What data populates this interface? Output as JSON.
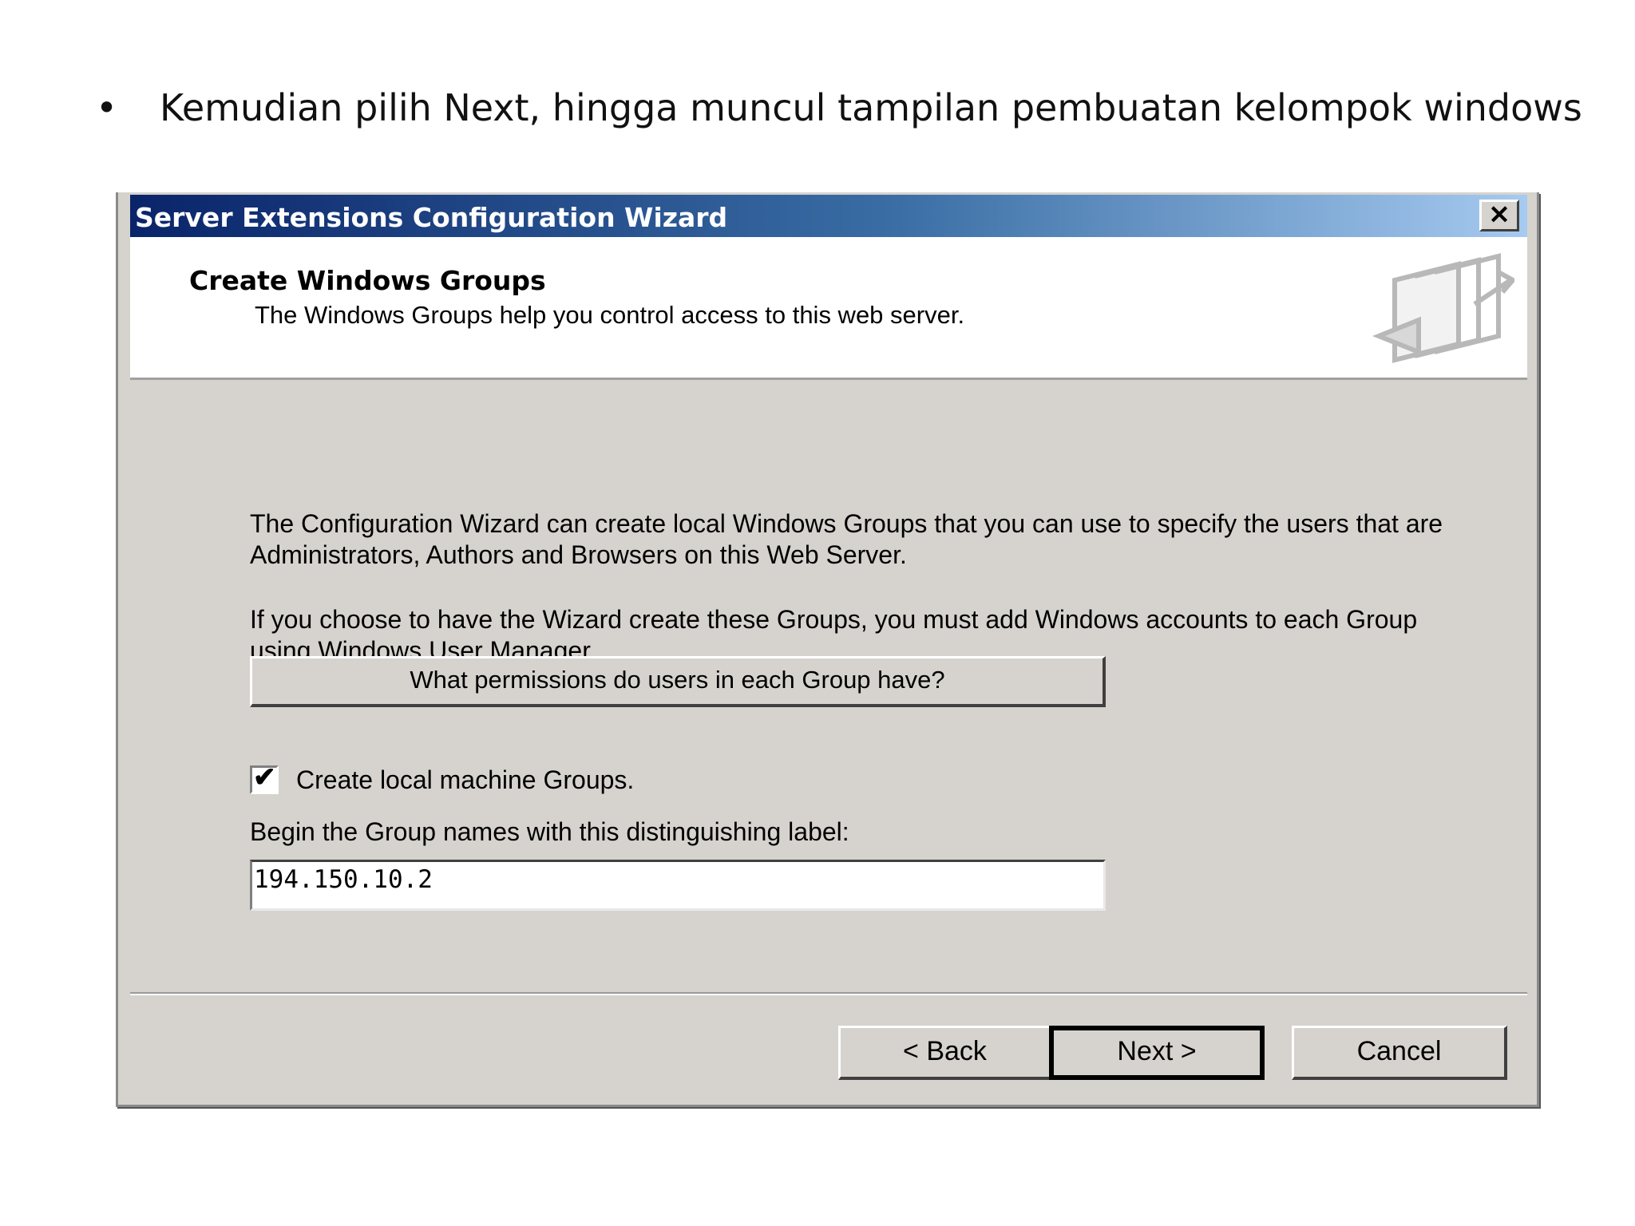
{
  "slide": {
    "bullet_symbol": "•",
    "bullet_text": "Kemudian pilih Next, hingga muncul tampilan pembuatan kelompok windows"
  },
  "dialog": {
    "title": "Server Extensions Configuration Wizard",
    "close_label": "✕",
    "header": {
      "title": "Create Windows Groups",
      "subtitle": "The Windows Groups help you control access to this web server."
    },
    "paragraph_1": "The Configuration Wizard can create local Windows Groups that you can use to specify the users that are Administrators, Authors and Browsers on this Web Server.",
    "paragraph_2": "If you choose to have the Wizard create these Groups, you must add Windows accounts to each Group using Windows User Manager.",
    "permissions_button": "What permissions do users in each Group have?",
    "checkbox": {
      "label": "Create local machine Groups.",
      "checked": true
    },
    "field_label": "Begin the Group names with this distinguishing label:",
    "field_value": "194.150.10.2",
    "buttons": {
      "back": "< Back",
      "next": "Next >",
      "cancel": "Cancel"
    }
  }
}
